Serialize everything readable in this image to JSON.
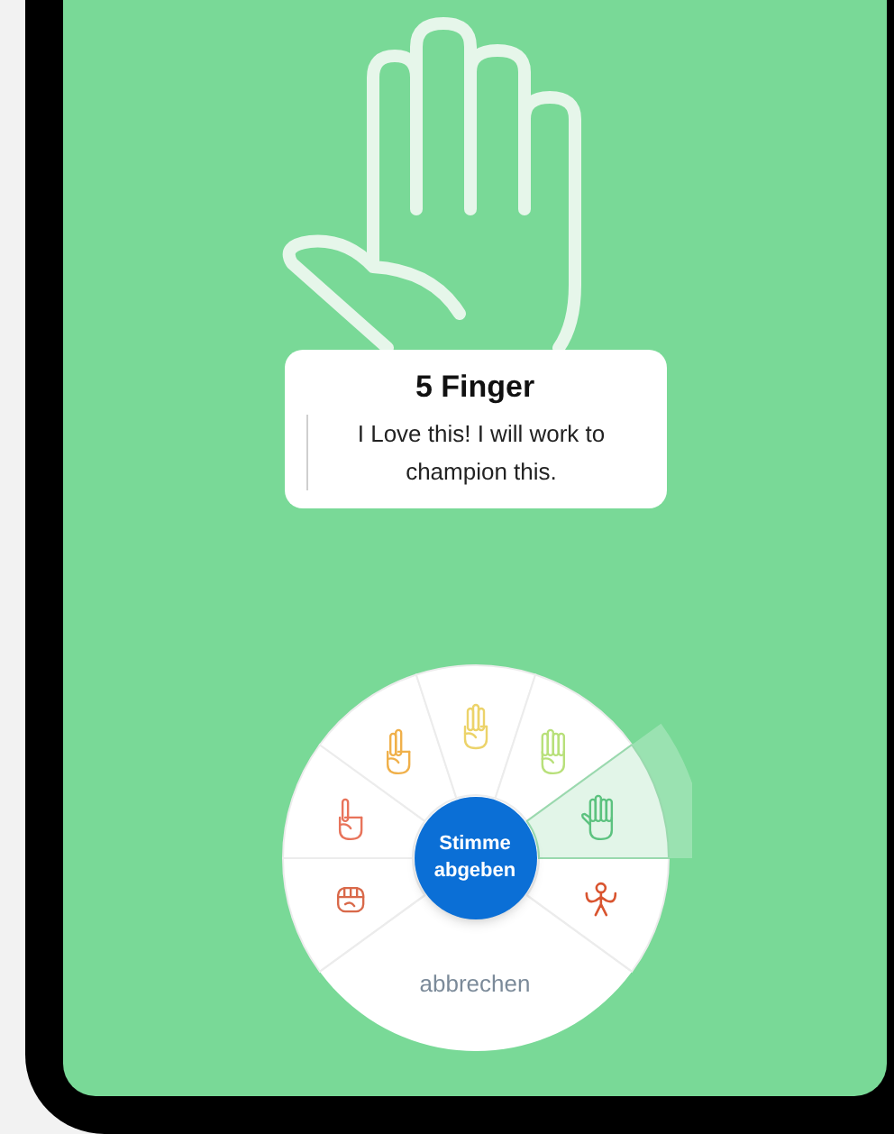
{
  "result": {
    "title": "5 Finger",
    "description": "I Love this! I will work to champion this."
  },
  "vote_wheel": {
    "options": [
      {
        "kind": "person",
        "color": "#d9542f",
        "selected": false
      },
      {
        "kind": "fist",
        "color": "#d9694a",
        "selected": false
      },
      {
        "kind": "one",
        "color": "#e8735a",
        "selected": false
      },
      {
        "kind": "two",
        "color": "#f0b04a",
        "selected": false
      },
      {
        "kind": "three",
        "color": "#ecd36a",
        "selected": false
      },
      {
        "kind": "four",
        "color": "#b8e07a",
        "selected": false
      },
      {
        "kind": "five",
        "color": "#5cc27f",
        "selected": true
      }
    ],
    "submit_button": "Stimme abgeben",
    "cancel_button": "abbrechen"
  }
}
